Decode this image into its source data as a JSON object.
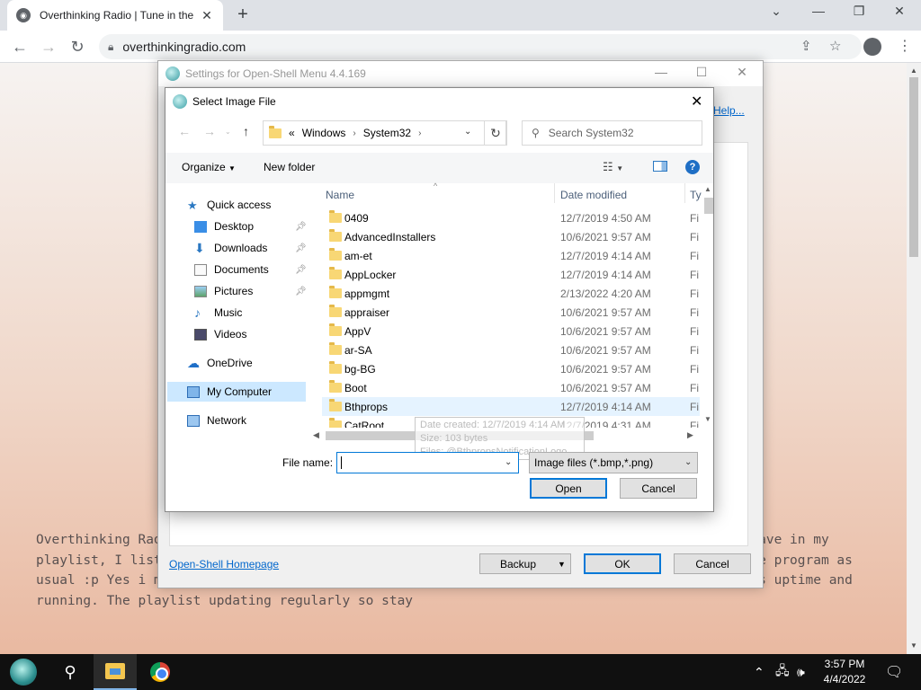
{
  "browser": {
    "tab_title": "Overthinking Radio | Tune in the",
    "tab_close": "✕",
    "new_tab": "+",
    "url": "overthinkingradio.com",
    "window_controls": [
      "⌄",
      "—",
      "❐",
      "✕"
    ]
  },
  "page": {
    "body_text": "Overthinking Radio is a new web radio station that plays 24/7 some of my favourite songs I have in my playlist, I listen to many of music genres so someday you may listen songs that aren't in the program as usual :p Yes i made this website myself and thanks to my Raspberry Pi 4 the station is always uptime and running. The playlist updating regularly so stay"
  },
  "settings_window": {
    "title": "Settings for Open-Shell Menu 4.4.169",
    "help_link": "Help...",
    "homepage_link": "Open-Shell Homepage",
    "backup_label": "Backup",
    "ok_label": "OK",
    "cancel_label": "Cancel"
  },
  "dialog": {
    "title": "Select Image File",
    "address": {
      "prefix": "«",
      "crumbs": [
        "Windows",
        "System32"
      ]
    },
    "search_placeholder": "Search System32",
    "organize_label": "Organize",
    "new_folder_label": "New folder",
    "help_glyph": "?",
    "nav": [
      {
        "label": "Quick access",
        "icon": "star-icon",
        "pinned": false
      },
      {
        "label": "Desktop",
        "icon": "desktop-icon",
        "pinned": true
      },
      {
        "label": "Downloads",
        "icon": "download-icon",
        "pinned": true
      },
      {
        "label": "Documents",
        "icon": "documents-icon",
        "pinned": true
      },
      {
        "label": "Pictures",
        "icon": "pictures-icon",
        "pinned": true
      },
      {
        "label": "Music",
        "icon": "music-icon",
        "pinned": false
      },
      {
        "label": "Videos",
        "icon": "videos-icon",
        "pinned": false
      },
      {
        "label": "OneDrive",
        "icon": "cloud-icon",
        "pinned": false
      },
      {
        "label": "My Computer",
        "icon": "computer-icon",
        "pinned": false
      },
      {
        "label": "Network",
        "icon": "network-icon",
        "pinned": false
      }
    ],
    "columns": {
      "name": "Name",
      "date": "Date modified",
      "type": "Ty"
    },
    "files": [
      {
        "name": "0409",
        "date": "12/7/2019 4:50 AM",
        "type": "Fi"
      },
      {
        "name": "AdvancedInstallers",
        "date": "10/6/2021 9:57 AM",
        "type": "Fi"
      },
      {
        "name": "am-et",
        "date": "12/7/2019 4:14 AM",
        "type": "Fi"
      },
      {
        "name": "AppLocker",
        "date": "12/7/2019 4:14 AM",
        "type": "Fi"
      },
      {
        "name": "appmgmt",
        "date": "2/13/2022 4:20 AM",
        "type": "Fi"
      },
      {
        "name": "appraiser",
        "date": "10/6/2021 9:57 AM",
        "type": "Fi"
      },
      {
        "name": "AppV",
        "date": "10/6/2021 9:57 AM",
        "type": "Fi"
      },
      {
        "name": "ar-SA",
        "date": "10/6/2021 9:57 AM",
        "type": "Fi"
      },
      {
        "name": "bg-BG",
        "date": "10/6/2021 9:57 AM",
        "type": "Fi"
      },
      {
        "name": "Boot",
        "date": "10/6/2021 9:57 AM",
        "type": "Fi"
      },
      {
        "name": "Bthprops",
        "date": "12/7/2019 4:14 AM",
        "type": "Fi"
      },
      {
        "name": "CatRoot",
        "date": "12/7/2019 4:31 AM",
        "type": "Fi"
      }
    ],
    "tooltip": {
      "line1": "Date created: 12/7/2019 4:14 AM",
      "line2": "Size: 103 bytes",
      "line3": "Files: @BthpropsNotificationLogo"
    },
    "file_name_label": "File name:",
    "file_name_value": "",
    "filter_label": "Image files (*.bmp,*.png)",
    "open_label": "Open",
    "cancel_label": "Cancel"
  },
  "taskbar": {
    "time": "3:57 PM",
    "date": "4/4/2022"
  },
  "colors": {
    "accent": "#0078d7",
    "selection": "#cce8ff",
    "hover": "#e5f3ff",
    "link": "#0066cc"
  }
}
